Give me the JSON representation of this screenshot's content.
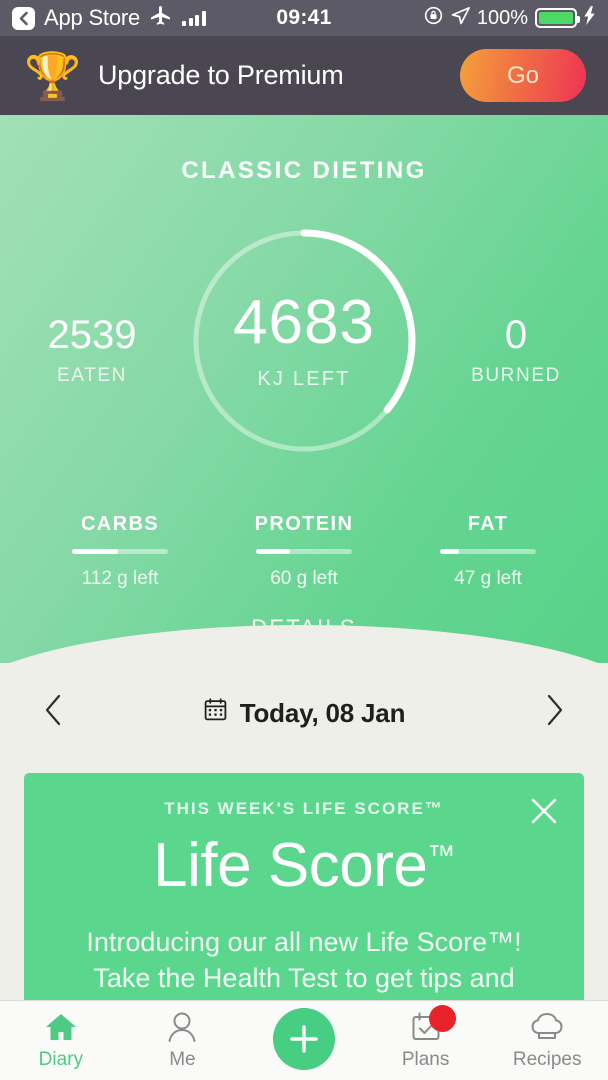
{
  "status_bar": {
    "back_label": "App Store",
    "time": "09:41",
    "battery_percent": "100%",
    "icons": [
      "back-chevron-icon",
      "airplane-mode-icon",
      "signal-bars-icon",
      "rotation-lock-icon",
      "location-arrow-icon",
      "battery-icon",
      "charging-bolt-icon"
    ]
  },
  "premium_banner": {
    "icon": "trophy-icon",
    "title": "Upgrade to Premium",
    "button_label": "Go",
    "gradient_from": "#F5A03C",
    "gradient_to": "#EE3355",
    "background": "#4A4652"
  },
  "hero": {
    "title": "CLASSIC DIETING",
    "ring": {
      "value": "4683",
      "label": "KJ LEFT",
      "progress_percent": 36
    },
    "eaten": {
      "value": "2539",
      "label": "EATEN"
    },
    "burned": {
      "value": "0",
      "label": "BURNED"
    },
    "macros": [
      {
        "name": "CARBS",
        "remaining": "112 g left",
        "progress_percent": 48
      },
      {
        "name": "PROTEIN",
        "remaining": "60 g left",
        "progress_percent": 35
      },
      {
        "name": "FAT",
        "remaining": "47 g left",
        "progress_percent": 20
      }
    ],
    "details_label": "DETAILS",
    "gradient_from": "#A2E0B6",
    "gradient_to": "#59D289"
  },
  "date_nav": {
    "prev_icon": "chevron-left-icon",
    "next_icon": "chevron-right-icon",
    "calendar_icon": "calendar-icon",
    "label": "Today, 08 Jan"
  },
  "life_score_card": {
    "kicker": "THIS WEEK'S LIFE SCORE™",
    "title": "Life Score",
    "title_tm": "™",
    "body": "Introducing our all new Life Score™! Take the Health Test to get tips and updates on your",
    "close_icon": "close-icon",
    "background": "#5BD68D"
  },
  "tab_bar": {
    "items": [
      {
        "label": "Diary",
        "icon": "home-icon",
        "active": true
      },
      {
        "label": "Me",
        "icon": "person-icon",
        "active": false
      },
      {
        "label": "Plans",
        "icon": "calendar-check-icon",
        "active": false,
        "badge": true
      },
      {
        "label": "Recipes",
        "icon": "chef-hat-icon",
        "active": false
      }
    ],
    "add_button_icon": "plus-icon",
    "active_color": "#4ECB82",
    "badge_color": "#E8232A"
  }
}
